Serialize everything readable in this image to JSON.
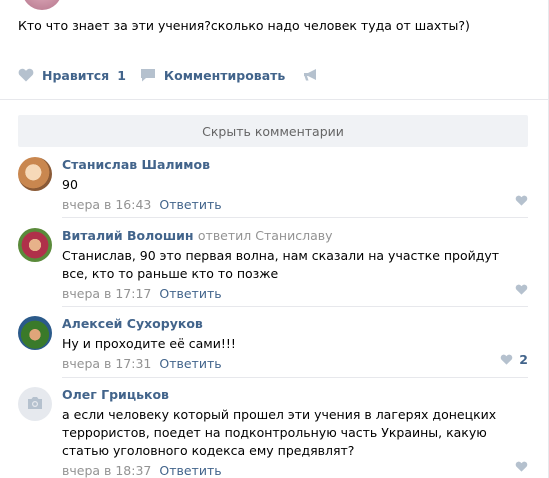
{
  "post": {
    "text": "Кто что знает за эти учения?сколько надо человек туда от шахты?)",
    "like_label": "Нравится",
    "like_count": "1",
    "comment_label": "Комментировать"
  },
  "hide_comments_label": "Скрыть комментарии",
  "comments": [
    {
      "author": "Станислав Шалимов",
      "replied": "",
      "text": "90",
      "time": "вчера в 16:43",
      "reply_label": "Ответить",
      "likes": ""
    },
    {
      "author": "Виталий Волошин",
      "replied": "ответил Станиславу",
      "text": "Станислав, 90 это первая волна, нам сказали на участке пройдут все, кто то раньше кто то позже",
      "time": "вчера в 17:17",
      "reply_label": "Ответить",
      "likes": ""
    },
    {
      "author": "Алексей Сухоруков",
      "replied": "",
      "text": "Ну и проходите её сами!!!",
      "time": "вчера в 17:31",
      "reply_label": "Ответить",
      "likes": "2"
    },
    {
      "author": "Олег Грицьков",
      "replied": "",
      "text": "а если человеку который прошел эти учения в лагерях донецких террористов, поедет на подконтрольную часть Украины, какую статью уголовного кодекса ему предявлят?",
      "time": "вчера в 18:37",
      "reply_label": "Ответить",
      "likes": ""
    }
  ],
  "colors": {
    "link": "#42648b",
    "meta": "#939393",
    "icon": "#b5c1ce",
    "button_bg": "#f0f2f5",
    "divider": "#e7e8ec"
  },
  "icons": {
    "like": "heart-icon",
    "comment": "speech-bubble-icon",
    "share": "megaphone-icon",
    "no_avatar": "camera-icon"
  }
}
